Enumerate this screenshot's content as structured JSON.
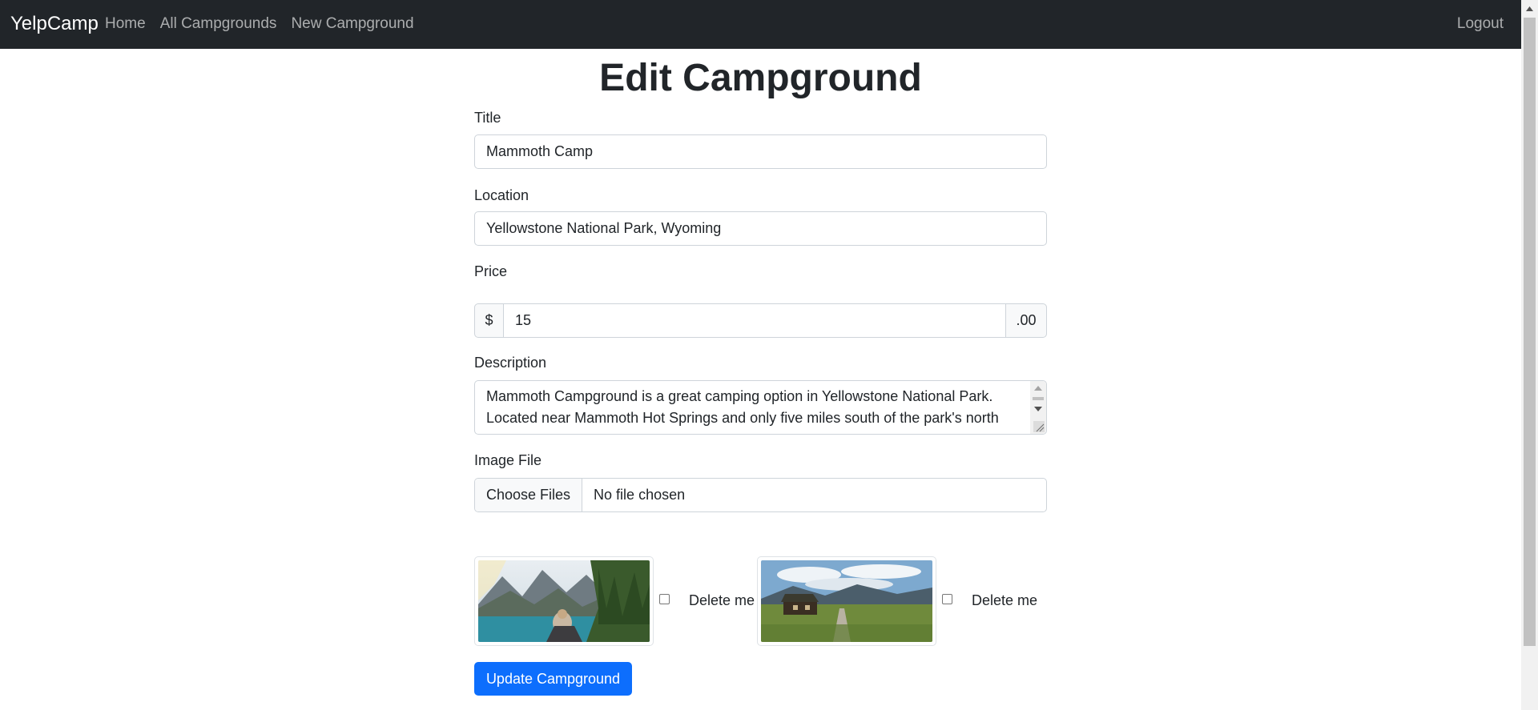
{
  "navbar": {
    "brand": "YelpCamp",
    "links": [
      {
        "label": "Home"
      },
      {
        "label": "All Campgrounds"
      },
      {
        "label": "New Campground"
      }
    ],
    "logout": "Logout"
  },
  "page": {
    "title": "Edit Campground"
  },
  "form": {
    "title": {
      "label": "Title",
      "value": "Mammoth Camp"
    },
    "location": {
      "label": "Location",
      "value": "Yellowstone National Park, Wyoming"
    },
    "price": {
      "label": "Price",
      "prefix": "$",
      "value": "15",
      "suffix": ".00"
    },
    "description": {
      "label": "Description",
      "value": "Mammoth Campground is a great camping option in Yellowstone National Park. Located near Mammoth Hot Springs and only five miles south of the park's north"
    },
    "image": {
      "label": "Image File",
      "button": "Choose Files",
      "status": "No file chosen"
    },
    "thumbnails": [
      {
        "alt": "mountain-lake-photo",
        "delete_label": "Delete me",
        "checked": false
      },
      {
        "alt": "cabin-meadow-photo",
        "delete_label": "Delete me",
        "checked": false
      }
    ],
    "submit": "Update Campground"
  },
  "colors": {
    "navbar": "#212529",
    "primary": "#0d6efd",
    "border": "#ced4da",
    "text": "#212529"
  }
}
